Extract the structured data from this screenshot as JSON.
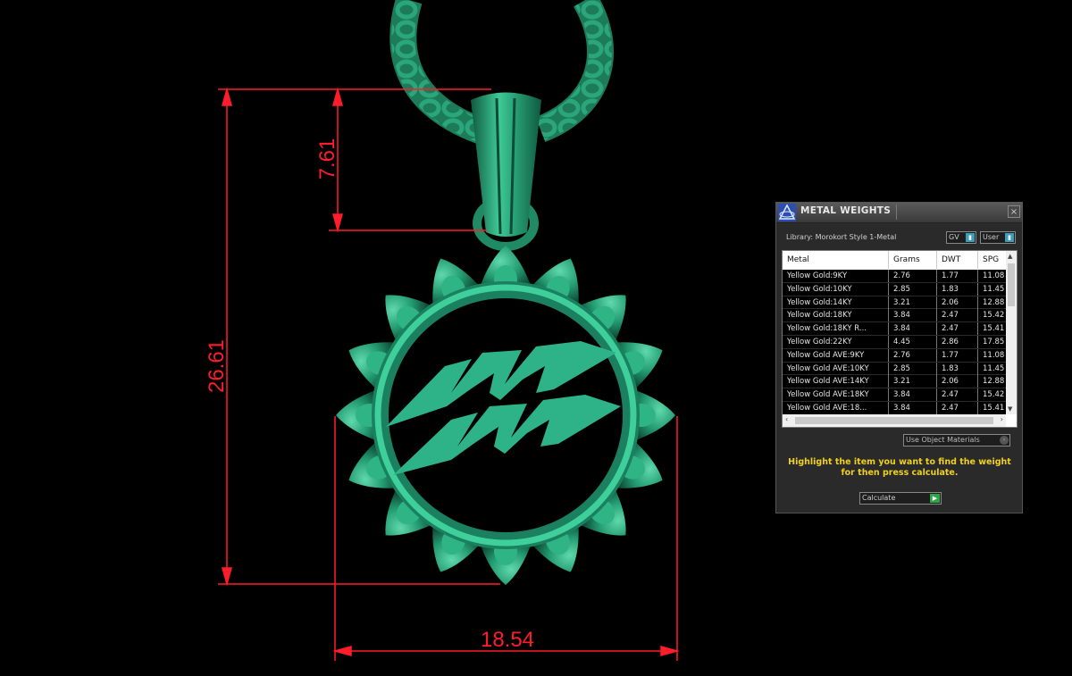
{
  "dimensions": {
    "height_total": "26.61",
    "bail_height": "7.61",
    "width": "18.54"
  },
  "colors": {
    "dimension_red": "#ff1c2b",
    "model_green": "#2bab85",
    "panel_bg": "#2a2a2a",
    "instruction_yellow": "#f0d020"
  },
  "panel": {
    "title": "METAL WEIGHTS",
    "close_icon": "×",
    "library_label": "Library: Morokort Style 1-Metal",
    "gv_combo": "GV",
    "user_combo": "User",
    "columns": [
      "Metal",
      "Grams",
      "DWT",
      "SPG"
    ],
    "rows": [
      [
        "Yellow Gold:9KY",
        "2.76",
        "1.77",
        "11.08"
      ],
      [
        "Yellow Gold:10KY",
        "2.85",
        "1.83",
        "11.45"
      ],
      [
        "Yellow Gold:14KY",
        "3.21",
        "2.06",
        "12.88"
      ],
      [
        "Yellow Gold:18KY",
        "3.84",
        "2.47",
        "15.42"
      ],
      [
        "Yellow Gold:18KY R...",
        "3.84",
        "2.47",
        "15.41"
      ],
      [
        "Yellow Gold:22KY",
        "4.45",
        "2.86",
        "17.85"
      ],
      [
        "Yellow Gold AVE:9KY",
        "2.76",
        "1.77",
        "11.08"
      ],
      [
        "Yellow Gold AVE:10KY",
        "2.85",
        "1.83",
        "11.45"
      ],
      [
        "Yellow Gold AVE:14KY",
        "3.21",
        "2.06",
        "12.88"
      ],
      [
        "Yellow Gold AVE:18KY",
        "3.84",
        "2.47",
        "15.42"
      ],
      [
        "Yellow Gold AVE:18...",
        "3.84",
        "2.47",
        "15.41"
      ]
    ],
    "use_object_label": "Use Object Materials",
    "instructions": "Highlight the item you want to find the weight for then press calculate.",
    "calculate_label": "Calculate"
  }
}
